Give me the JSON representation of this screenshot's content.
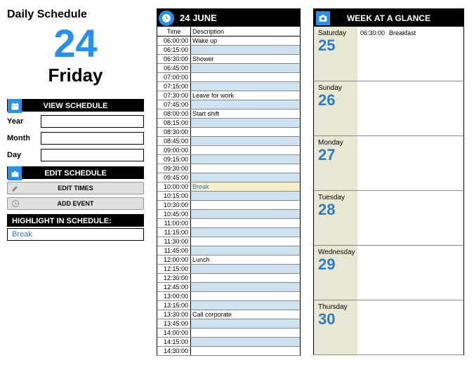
{
  "title": "Daily Schedule",
  "bigDate": "24",
  "dayName": "Friday",
  "viewSchedule": "VIEW SCHEDULE",
  "fields": {
    "year": "Year",
    "month": "Month",
    "day": "Day"
  },
  "editSchedule": "EDIT SCHEDULE",
  "btnEditTimes": "EDIT TIMES",
  "btnAddEvent": "ADD EVENT",
  "highlightLabel": "HIGHLIGHT IN SCHEDULE:",
  "highlightValue": "Break",
  "mid": {
    "title": "24 JUNE",
    "colTime": "Time",
    "colDesc": "Description",
    "rows": [
      {
        "t": "06:00:00",
        "d": "Wake up",
        "alt": false
      },
      {
        "t": "06:15:00",
        "d": "",
        "alt": true
      },
      {
        "t": "06:30:00",
        "d": "Shower",
        "alt": false
      },
      {
        "t": "06:45:00",
        "d": "",
        "alt": true
      },
      {
        "t": "07:00:00",
        "d": "",
        "alt": false
      },
      {
        "t": "07:15:00",
        "d": "",
        "alt": true
      },
      {
        "t": "07:30:00",
        "d": "Leave for work",
        "alt": false
      },
      {
        "t": "07:45:00",
        "d": "",
        "alt": true
      },
      {
        "t": "08:00:00",
        "d": "Start shift",
        "alt": false
      },
      {
        "t": "08:15:00",
        "d": "",
        "alt": true
      },
      {
        "t": "08:30:00",
        "d": "",
        "alt": false
      },
      {
        "t": "08:45:00",
        "d": "",
        "alt": true
      },
      {
        "t": "09:00:00",
        "d": "",
        "alt": false
      },
      {
        "t": "09:15:00",
        "d": "",
        "alt": true
      },
      {
        "t": "09:30:00",
        "d": "",
        "alt": false
      },
      {
        "t": "09:45:00",
        "d": "",
        "alt": true
      },
      {
        "t": "10:00:00",
        "d": "Break",
        "hi": true
      },
      {
        "t": "10:15:00",
        "d": "",
        "alt": true
      },
      {
        "t": "10:30:00",
        "d": "",
        "alt": false
      },
      {
        "t": "10:45:00",
        "d": "",
        "alt": true
      },
      {
        "t": "11:00:00",
        "d": "",
        "alt": false
      },
      {
        "t": "11:15:00",
        "d": "",
        "alt": true
      },
      {
        "t": "11:30:00",
        "d": "",
        "alt": false
      },
      {
        "t": "11:45:00",
        "d": "",
        "alt": true
      },
      {
        "t": "12:00:00",
        "d": "Lunch",
        "alt": false
      },
      {
        "t": "12:15:00",
        "d": "",
        "alt": true
      },
      {
        "t": "12:30:00",
        "d": "",
        "alt": false
      },
      {
        "t": "12:45:00",
        "d": "",
        "alt": true
      },
      {
        "t": "13:00:00",
        "d": "",
        "alt": false
      },
      {
        "t": "13:15:00",
        "d": "",
        "alt": true
      },
      {
        "t": "13:30:00",
        "d": "Call corporate",
        "alt": false
      },
      {
        "t": "13:45:00",
        "d": "",
        "alt": true
      },
      {
        "t": "14:00:00",
        "d": "",
        "alt": false
      },
      {
        "t": "14:15:00",
        "d": "",
        "alt": true
      },
      {
        "t": "14:30:00",
        "d": "",
        "alt": false
      }
    ]
  },
  "week": {
    "title": "WEEK AT A GLANCE",
    "days": [
      {
        "name": "Saturday",
        "num": "25",
        "time": "06:30:00",
        "event": "Breakfast"
      },
      {
        "name": "Sunday",
        "num": "26"
      },
      {
        "name": "Monday",
        "num": "27"
      },
      {
        "name": "Tuesday",
        "num": "28"
      },
      {
        "name": "Wednesday",
        "num": "29"
      },
      {
        "name": "Thursday",
        "num": "30"
      }
    ]
  }
}
